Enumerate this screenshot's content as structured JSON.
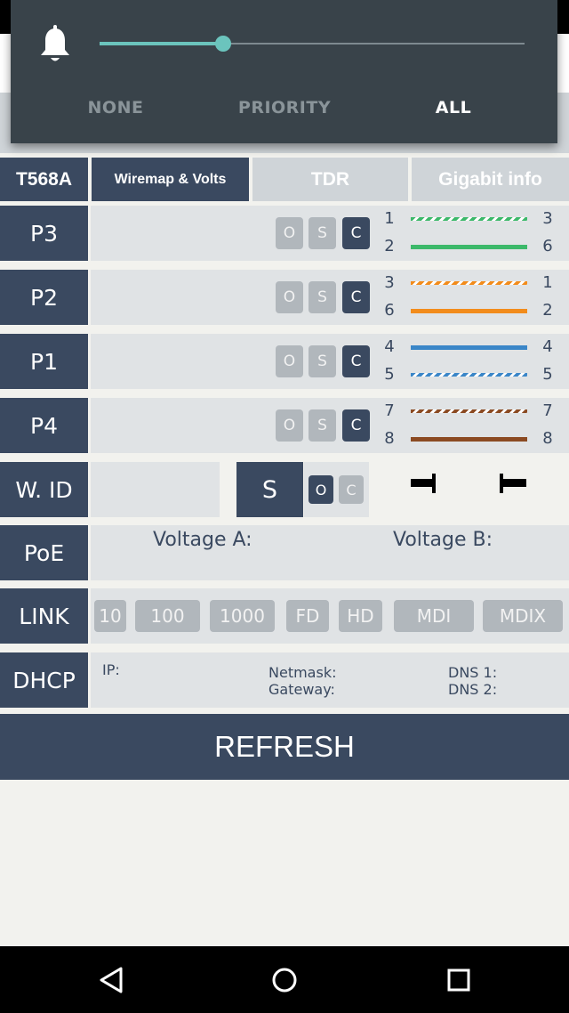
{
  "notification": {
    "modes": [
      "NONE",
      "PRIORITY",
      "ALL"
    ],
    "active_mode": "ALL",
    "volume_level": 0.29
  },
  "tabs": {
    "standard": "T568A",
    "wiremap": "Wiremap & Volts",
    "tdr": "TDR",
    "gigabit": "Gigabit info"
  },
  "pairs": [
    {
      "label": "P3",
      "btns": [
        "O",
        "S",
        "C"
      ],
      "active": "C",
      "wires": [
        {
          "left": "1",
          "right": "3",
          "color": "#3cb96a",
          "striped": true
        },
        {
          "left": "2",
          "right": "6",
          "color": "#3cb96a",
          "striped": false
        }
      ]
    },
    {
      "label": "P2",
      "btns": [
        "O",
        "S",
        "C"
      ],
      "active": "C",
      "wires": [
        {
          "left": "3",
          "right": "1",
          "color": "#f28c1c",
          "striped": true
        },
        {
          "left": "6",
          "right": "2",
          "color": "#f28c1c",
          "striped": false
        }
      ]
    },
    {
      "label": "P1",
      "btns": [
        "O",
        "S",
        "C"
      ],
      "active": "C",
      "wires": [
        {
          "left": "4",
          "right": "4",
          "color": "#3a86c8",
          "striped": false
        },
        {
          "left": "5",
          "right": "5",
          "color": "#3a86c8",
          "striped": true
        }
      ]
    },
    {
      "label": "P4",
      "btns": [
        "O",
        "S",
        "C"
      ],
      "active": "C",
      "wires": [
        {
          "left": "7",
          "right": "7",
          "color": "#8b4a22",
          "striped": true
        },
        {
          "left": "8",
          "right": "8",
          "color": "#8b4a22",
          "striped": false
        }
      ]
    }
  ],
  "wid": {
    "label": "W. ID",
    "s": "S",
    "o": "O",
    "c": "C"
  },
  "poe": {
    "label": "PoE",
    "voltage_a": "Voltage A:",
    "voltage_b": "Voltage B:"
  },
  "link": {
    "label": "LINK",
    "buttons": [
      "10",
      "100",
      "1000",
      "FD",
      "HD",
      "MDI",
      "MDIX"
    ]
  },
  "dhcp": {
    "label": "DHCP",
    "ip": "IP:",
    "netmask": "Netmask:",
    "gateway": "Gateway:",
    "dns1": "DNS 1:",
    "dns2": "DNS 2:"
  },
  "refresh_label": "REFRESH",
  "colors": {
    "primary": "#3a4960",
    "accent": "#6bc4bd",
    "inactive": "#b1b7bc"
  },
  "nav": {
    "back": "back-icon",
    "home": "home-icon",
    "recents": "recents-icon"
  }
}
